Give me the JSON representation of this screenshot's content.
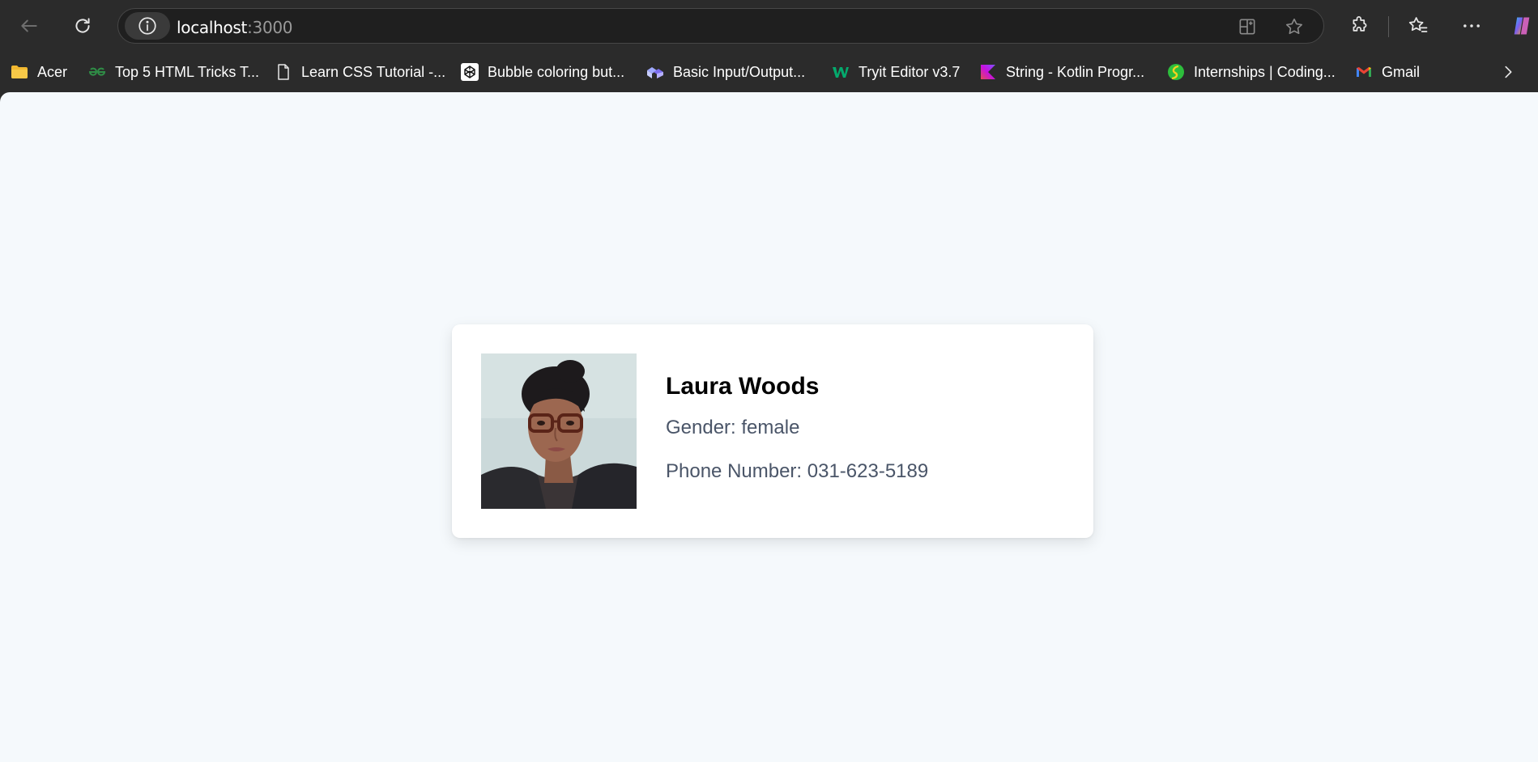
{
  "browser": {
    "url_host": "localhost",
    "url_port": ":3000",
    "bookmarks": [
      {
        "label": "Acer",
        "icon": "folder-icon"
      },
      {
        "label": "Top 5 HTML Tricks T...",
        "icon": "geeksforgeeks-icon"
      },
      {
        "label": "Learn CSS Tutorial -...",
        "icon": "page-icon"
      },
      {
        "label": "Bubble coloring but...",
        "icon": "codepen-icon"
      },
      {
        "label": "Basic Input/Output...",
        "icon": "blocks-icon"
      },
      {
        "label": "Tryit Editor v3.7",
        "icon": "w3schools-icon"
      },
      {
        "label": "String - Kotlin Progr...",
        "icon": "kotlin-icon"
      },
      {
        "label": "Internships | Coding...",
        "icon": "coding-site-icon"
      },
      {
        "label": "Gmail",
        "icon": "gmail-icon"
      }
    ]
  },
  "profile": {
    "name": "Laura Woods",
    "gender_label": "Gender: female",
    "phone_label": "Phone Number: 031-623-5189"
  },
  "colors": {
    "page_background": "#f5f9fc",
    "card_background": "#ffffff",
    "name_text": "#000000",
    "detail_text": "#4a5568",
    "chrome": "#2b2b2b"
  }
}
